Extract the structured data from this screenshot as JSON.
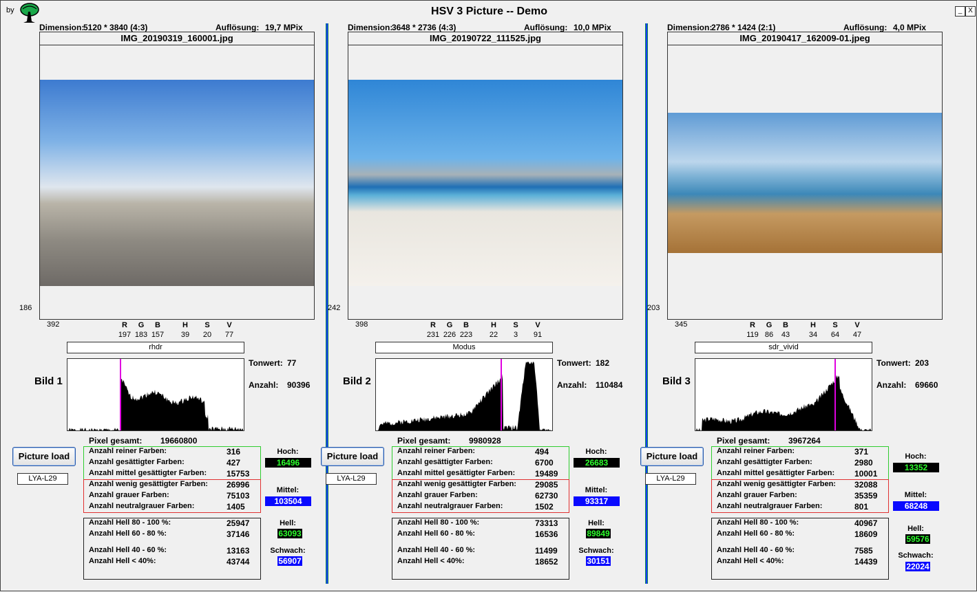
{
  "app": {
    "by": "by",
    "title": "HSV 3 Picture -- Demo",
    "min_btn": "_",
    "close_btn": "X"
  },
  "labels": {
    "dimension": "Dimension:",
    "resolution": "Auflösung:",
    "R": "R",
    "G": "G",
    "B": "B",
    "H": "H",
    "S": "S",
    "V": "V",
    "tonwert": "Tonwert:",
    "anzahl": "Anzahl:",
    "pixel_total": "Pixel gesamt:",
    "reiner": "Anzahl reiner Farben:",
    "gesaettigter": "Anzahl gesättigter Farben:",
    "mittel_ges": "Anzahl mittel gesättigter Farben:",
    "wenig_ges": "Anzahl wenig gesättigter Farben:",
    "grauer": "Anzahl grauer Farben:",
    "neutralgrauer": "Anzahl neutralgrauer Farben:",
    "hell80": "Anzahl Hell 80 - 100 %:",
    "hell60": "Anzahl Hell 60 - 80 %:",
    "hell40": "Anzahl Hell 40 - 60 %:",
    "hell_lt40": "Anzahl Hell < 40%:",
    "hoch": "Hoch:",
    "mittel": "Mittel:",
    "hell": "Hell:",
    "schwach": "Schwach:",
    "picture_load": "Picture load"
  },
  "panels": [
    {
      "dimension": "5120 * 3840 (4:3)",
      "resolution": "19,7 MPix",
      "filename": "IMG_20190319_160001.jpg",
      "coord_y": "186",
      "coord_x": "392",
      "rgb": {
        "r": "197",
        "g": "183",
        "b": "157"
      },
      "hsv": {
        "h": "39",
        "s": "20",
        "v": "77"
      },
      "mode": "rhdr",
      "bild": "Bild 1",
      "tonwert": "77",
      "anzahl": "90396",
      "marker": 77,
      "pixel_total": "19660800",
      "device": "LYA-L29",
      "reiner": "316",
      "gesaettigter": "427",
      "mittel_ges": "15753",
      "wenig_ges": "26996",
      "grauer": "75103",
      "neutralgrauer": "1405",
      "hell80": "25947",
      "hell60": "37146",
      "hell40": "13163",
      "hell_lt40": "43744",
      "hoch": "16496",
      "mittel": "103504",
      "hell": "63093",
      "schwach": "56907"
    },
    {
      "dimension": "3648 * 2736 (4:3)",
      "resolution": "10,0 MPix",
      "filename": "IMG_20190722_111525.jpg",
      "coord_y": "242",
      "coord_x": "398",
      "rgb": {
        "r": "231",
        "g": "226",
        "b": "223"
      },
      "hsv": {
        "h": "22",
        "s": "3",
        "v": "91"
      },
      "mode": "Modus",
      "bild": "Bild 2",
      "tonwert": "182",
      "anzahl": "110484",
      "marker": 182,
      "pixel_total": "9980928",
      "device": "LYA-L29",
      "reiner": "494",
      "gesaettigter": "6700",
      "mittel_ges": "19489",
      "wenig_ges": "29085",
      "grauer": "62730",
      "neutralgrauer": "1502",
      "hell80": "73313",
      "hell60": "16536",
      "hell40": "11499",
      "hell_lt40": "18652",
      "hoch": "26683",
      "mittel": "93317",
      "hell": "89849",
      "schwach": "30151"
    },
    {
      "dimension": "2786 * 1424 (2:1)",
      "resolution": "4,0 MPix",
      "filename": "IMG_20190417_162009-01.jpeg",
      "coord_y": "203",
      "coord_x": "345",
      "rgb": {
        "r": "119",
        "g": "86",
        "b": "43"
      },
      "hsv": {
        "h": "34",
        "s": "64",
        "v": "47"
      },
      "mode": "sdr_vivid",
      "bild": "Bild 3",
      "tonwert": "203",
      "anzahl": "69660",
      "marker": 203,
      "pixel_total": "3967264",
      "device": "LYA-L29",
      "reiner": "371",
      "gesaettigter": "2980",
      "mittel_ges": "10001",
      "wenig_ges": "32088",
      "grauer": "35359",
      "neutralgrauer": "801",
      "hell80": "40967",
      "hell60": "18609",
      "hell40": "7585",
      "hell_lt40": "14439",
      "hoch": "13352",
      "mittel": "68248",
      "hell": "59576",
      "schwach": "22024"
    }
  ],
  "colors": {
    "marker": "#e000e0",
    "badge_dark": "#000000",
    "badge_blue": "#0a0aff",
    "badge_green_text": "#2dff2d"
  }
}
